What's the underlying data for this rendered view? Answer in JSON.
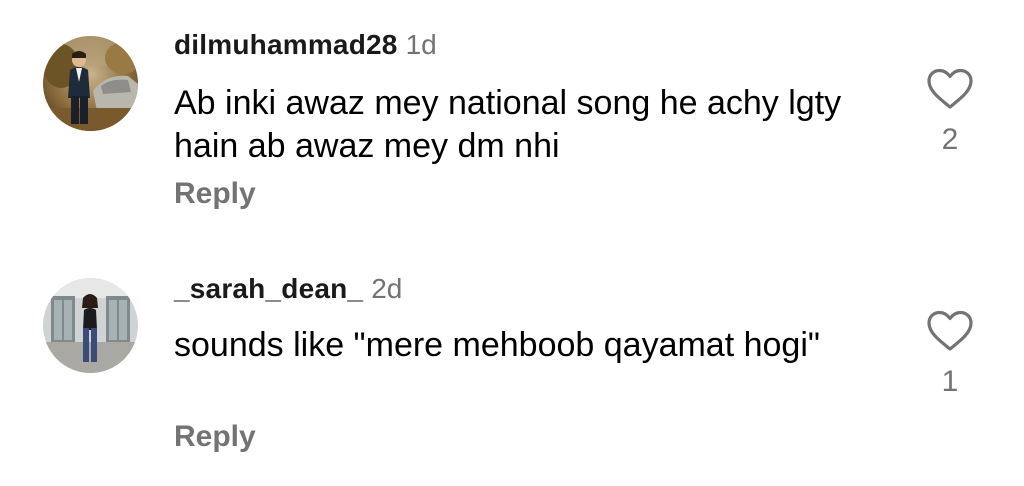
{
  "comments": [
    {
      "username": "dilmuhammad28",
      "time": "1d",
      "text": "Ab inki awaz mey national song he achy lgty hain ab awaz mey dm nhi",
      "reply_label": "Reply",
      "like_count": "2",
      "avatar_icon": "profile-photo-man-by-car"
    },
    {
      "username": "_sarah_dean_",
      "time": "2d",
      "text": "sounds like \"mere mehboob qayamat hogi\"",
      "reply_label": "Reply",
      "like_count": "1",
      "avatar_icon": "profile-photo-woman-standing"
    }
  ],
  "colors": {
    "username": "#1a1a1a",
    "secondary_text": "#737373",
    "body_text": "#000000",
    "background": "#ffffff",
    "heart_outline": "#737373"
  },
  "icons": {
    "like": "heart-outline-icon"
  }
}
